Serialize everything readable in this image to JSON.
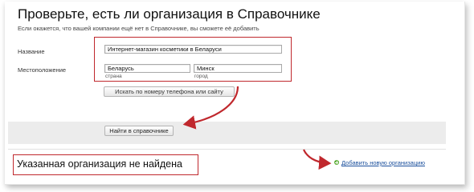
{
  "page": {
    "title": "Проверьте, есть ли организация в Справочнике",
    "subtitle": "Если окажется, что вашей компании ещё нет в Справочнике, вы сможете её добавить"
  },
  "form": {
    "name_label": "Название",
    "name_value": "Интернет-магазин косметики в Беларуси",
    "location_label": "Местоположение",
    "country_value": "Беларусь",
    "country_hint": "страна",
    "city_value": "Минск",
    "city_hint": "город",
    "phone_search_label": "Искать по номеру телефона или сайту",
    "submit_label": "Найти в справочнике"
  },
  "result": {
    "not_found_text": "Указанная организация не найдена",
    "add_link_text": "Добавить новую организацию"
  },
  "icons": {
    "add": "plus-circle-icon"
  },
  "colors": {
    "annotation_red": "#c0282d",
    "link_blue": "#1a4f9c",
    "add_green": "#5fae3a",
    "band_gray": "#ececec"
  }
}
